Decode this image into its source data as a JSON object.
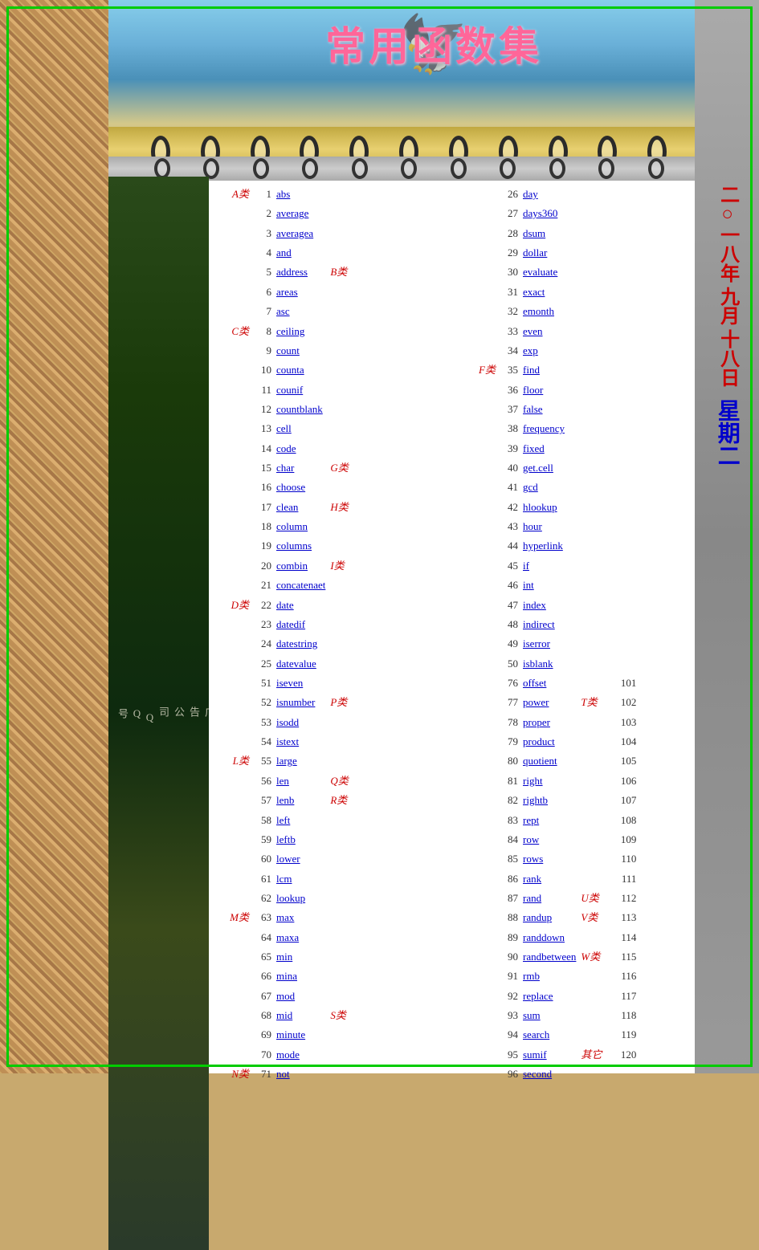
{
  "title": "常用函数集",
  "date": {
    "year": "二○一八年",
    "month": "九月",
    "day": "十八日",
    "weekday": "星期二"
  },
  "left_col_functions": [
    {
      "num": 1,
      "name": "abs",
      "cat": "A类",
      "catPos": "before"
    },
    {
      "num": 2,
      "name": "average",
      "cat": "",
      "catPos": ""
    },
    {
      "num": 3,
      "name": "averagea",
      "cat": "",
      "catPos": ""
    },
    {
      "num": 4,
      "name": "and",
      "cat": "",
      "catPos": ""
    },
    {
      "num": 5,
      "name": "address",
      "cat": "B类",
      "catPos": "after"
    },
    {
      "num": 6,
      "name": "areas",
      "cat": "",
      "catPos": ""
    },
    {
      "num": 7,
      "name": "asc",
      "cat": "",
      "catPos": ""
    },
    {
      "num": 8,
      "name": "ceiling",
      "cat": "C类",
      "catPos": "before"
    },
    {
      "num": 9,
      "name": "count",
      "cat": "",
      "catPos": ""
    },
    {
      "num": 10,
      "name": "counta",
      "cat": "",
      "catPos": ""
    },
    {
      "num": 11,
      "name": "counif",
      "cat": "",
      "catPos": ""
    },
    {
      "num": 12,
      "name": "countblank",
      "cat": "",
      "catPos": ""
    },
    {
      "num": 13,
      "name": "cell",
      "cat": "",
      "catPos": ""
    },
    {
      "num": 14,
      "name": "code",
      "cat": "",
      "catPos": ""
    },
    {
      "num": 15,
      "name": "char",
      "cat": "G类",
      "catPos": "after"
    },
    {
      "num": 16,
      "name": "choose",
      "cat": "",
      "catPos": ""
    },
    {
      "num": 17,
      "name": "clean",
      "cat": "H类",
      "catPos": "after"
    },
    {
      "num": 18,
      "name": "column",
      "cat": "",
      "catPos": ""
    },
    {
      "num": 19,
      "name": "columns",
      "cat": "",
      "catPos": ""
    },
    {
      "num": 20,
      "name": "combin",
      "cat": "I类",
      "catPos": "after"
    },
    {
      "num": 21,
      "name": "concatenaet",
      "cat": "",
      "catPos": ""
    },
    {
      "num": 22,
      "name": "date",
      "cat": "D类",
      "catPos": "before"
    },
    {
      "num": 23,
      "name": "datedif",
      "cat": "",
      "catPos": ""
    },
    {
      "num": 24,
      "name": "datestring",
      "cat": "",
      "catPos": ""
    },
    {
      "num": 25,
      "name": "datevalue",
      "cat": "",
      "catPos": ""
    },
    {
      "num": 51,
      "name": "iseven",
      "cat": "",
      "catPos": ""
    },
    {
      "num": 52,
      "name": "isnumber",
      "cat": "P类",
      "catPos": "after"
    },
    {
      "num": 53,
      "name": "isodd",
      "cat": "",
      "catPos": ""
    },
    {
      "num": 54,
      "name": "istext",
      "cat": "",
      "catPos": ""
    },
    {
      "num": 55,
      "name": "large",
      "cat": "L类",
      "catPos": "before"
    },
    {
      "num": 56,
      "name": "len",
      "cat": "Q类",
      "catPos": "after"
    },
    {
      "num": 57,
      "name": "lenb",
      "cat": "R类",
      "catPos": "after"
    },
    {
      "num": 58,
      "name": "left",
      "cat": "",
      "catPos": ""
    },
    {
      "num": 59,
      "name": "leftb",
      "cat": "",
      "catPos": ""
    },
    {
      "num": 60,
      "name": "lower",
      "cat": "",
      "catPos": ""
    },
    {
      "num": 61,
      "name": "lcm",
      "cat": "",
      "catPos": ""
    },
    {
      "num": 62,
      "name": "lookup",
      "cat": "",
      "catPos": ""
    },
    {
      "num": 63,
      "name": "max",
      "cat": "M类",
      "catPos": "before"
    },
    {
      "num": 64,
      "name": "maxa",
      "cat": "",
      "catPos": ""
    },
    {
      "num": 65,
      "name": "min",
      "cat": "",
      "catPos": ""
    },
    {
      "num": 66,
      "name": "mina",
      "cat": "",
      "catPos": ""
    },
    {
      "num": 67,
      "name": "mod",
      "cat": "",
      "catPos": ""
    },
    {
      "num": 68,
      "name": "mid",
      "cat": "S类",
      "catPos": "after"
    },
    {
      "num": 69,
      "name": "minute",
      "cat": "",
      "catPos": ""
    },
    {
      "num": 70,
      "name": "mode",
      "cat": "",
      "catPos": ""
    },
    {
      "num": 71,
      "name": "not",
      "cat": "N类",
      "catPos": "before"
    }
  ],
  "right_col_functions": [
    {
      "num": 26,
      "name": "day",
      "cat": "",
      "catPos": ""
    },
    {
      "num": 27,
      "name": "days360",
      "cat": "",
      "catPos": ""
    },
    {
      "num": 28,
      "name": "dsum",
      "cat": "",
      "catPos": ""
    },
    {
      "num": 29,
      "name": "dollar",
      "cat": "",
      "catPos": ""
    },
    {
      "num": 30,
      "name": "evaluate",
      "cat": "",
      "catPos": ""
    },
    {
      "num": 31,
      "name": "exact",
      "cat": "",
      "catPos": ""
    },
    {
      "num": 32,
      "name": "emonth",
      "cat": "",
      "catPos": ""
    },
    {
      "num": 33,
      "name": "even",
      "cat": "",
      "catPos": ""
    },
    {
      "num": 34,
      "name": "exp",
      "cat": "",
      "catPos": ""
    },
    {
      "num": 35,
      "name": "find",
      "cat": "F类",
      "catPos": "before"
    },
    {
      "num": 36,
      "name": "floor",
      "cat": "",
      "catPos": ""
    },
    {
      "num": 37,
      "name": "false",
      "cat": "",
      "catPos": ""
    },
    {
      "num": 38,
      "name": "frequency",
      "cat": "",
      "catPos": ""
    },
    {
      "num": 39,
      "name": "fixed",
      "cat": "",
      "catPos": ""
    },
    {
      "num": 40,
      "name": "get.cell",
      "cat": "",
      "catPos": ""
    },
    {
      "num": 41,
      "name": "gcd",
      "cat": "",
      "catPos": ""
    },
    {
      "num": 42,
      "name": "hlookup",
      "cat": "",
      "catPos": ""
    },
    {
      "num": 43,
      "name": "hour",
      "cat": "",
      "catPos": ""
    },
    {
      "num": 44,
      "name": "hyperlink",
      "cat": "",
      "catPos": ""
    },
    {
      "num": 45,
      "name": "if",
      "cat": "",
      "catPos": ""
    },
    {
      "num": 46,
      "name": "int",
      "cat": "",
      "catPos": ""
    },
    {
      "num": 47,
      "name": "index",
      "cat": "",
      "catPos": ""
    },
    {
      "num": 48,
      "name": "indirect",
      "cat": "",
      "catPos": ""
    },
    {
      "num": 49,
      "name": "iserror",
      "cat": "",
      "catPos": ""
    },
    {
      "num": 50,
      "name": "isblank",
      "cat": "",
      "catPos": ""
    },
    {
      "num": 76,
      "name": "offset",
      "cat": "",
      "catPos": ""
    },
    {
      "num": 77,
      "name": "power",
      "cat": "T类",
      "catPos": "after"
    },
    {
      "num": 78,
      "name": "proper",
      "cat": "",
      "catPos": ""
    },
    {
      "num": 79,
      "name": "product",
      "cat": "",
      "catPos": ""
    },
    {
      "num": 80,
      "name": "quotient",
      "cat": "",
      "catPos": ""
    },
    {
      "num": 81,
      "name": "right",
      "cat": "",
      "catPos": ""
    },
    {
      "num": 82,
      "name": "rightb",
      "cat": "",
      "catPos": ""
    },
    {
      "num": 83,
      "name": "rept",
      "cat": "",
      "catPos": ""
    },
    {
      "num": 84,
      "name": "row",
      "cat": "",
      "catPos": ""
    },
    {
      "num": 85,
      "name": "rows",
      "cat": "",
      "catPos": ""
    },
    {
      "num": 86,
      "name": "rank",
      "cat": "",
      "catPos": ""
    },
    {
      "num": 87,
      "name": "rand",
      "cat": "U类",
      "catPos": "after"
    },
    {
      "num": 88,
      "name": "randup",
      "cat": "V类",
      "catPos": "after"
    },
    {
      "num": 89,
      "name": "randdown",
      "cat": "",
      "catPos": ""
    },
    {
      "num": 90,
      "name": "randbetween",
      "cat": "W类",
      "catPos": "after"
    },
    {
      "num": 91,
      "name": "rmb",
      "cat": "",
      "catPos": ""
    },
    {
      "num": 92,
      "name": "replace",
      "cat": "",
      "catPos": ""
    },
    {
      "num": 93,
      "name": "sum",
      "cat": "",
      "catPos": ""
    },
    {
      "num": 94,
      "name": "search",
      "cat": "",
      "catPos": ""
    },
    {
      "num": 95,
      "name": "sumif",
      "cat": "其它",
      "catPos": "after"
    },
    {
      "num": 96,
      "name": "second",
      "cat": "",
      "catPos": ""
    }
  ],
  "right_numbers": [
    101,
    102,
    103,
    104,
    105,
    106,
    107,
    108,
    109,
    110,
    111,
    112,
    113,
    114,
    115,
    116,
    117,
    118,
    119,
    120
  ],
  "sidebar_texts": [
    "佛山年佳美广告公司",
    "QQ号"
  ],
  "categories": {
    "A": "A类",
    "B": "B类",
    "C": "C类",
    "D": "D类",
    "F": "F类",
    "G": "G类",
    "H": "H类",
    "I": "I类",
    "L": "L类",
    "M": "M类",
    "N": "N类",
    "P": "P类",
    "Q": "Q类",
    "R": "R类",
    "S": "S类",
    "T": "T类",
    "U": "U类",
    "V": "V类",
    "W": "W类"
  }
}
